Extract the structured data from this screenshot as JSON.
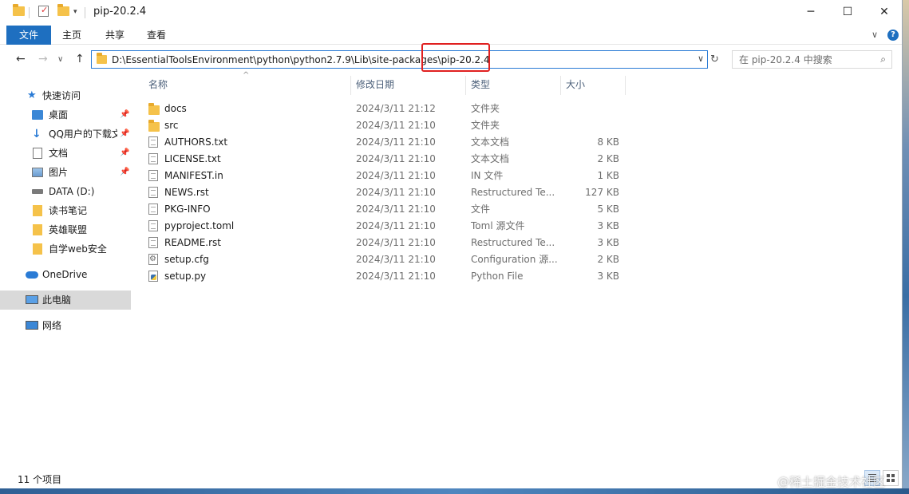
{
  "window": {
    "title": "pip-20.2.4"
  },
  "window_controls": {
    "minimize": "─",
    "maximize": "☐",
    "close": "✕"
  },
  "ribbon": {
    "tabs": [
      {
        "label": "文件"
      },
      {
        "label": "主页"
      },
      {
        "label": "共享"
      },
      {
        "label": "查看"
      }
    ],
    "expand": "∨",
    "help": "?"
  },
  "nav": {
    "back": "←",
    "forward": "→",
    "recent": "∨",
    "up": "↑",
    "address": "D:\\EssentialToolsEnvironment\\python\\python2.7.9\\Lib\\site-packages\\pip-20.2.4",
    "address_dropdown": "∨",
    "refresh": "↻",
    "search_placeholder": "在 pip-20.2.4 中搜索",
    "search_icon": "⌕"
  },
  "sidebar": {
    "items": [
      {
        "label": "快速访问",
        "icon": "star-icon",
        "pin": ""
      },
      {
        "label": "桌面",
        "icon": "desktop-icon",
        "pin": "📌"
      },
      {
        "label": "QQ用户的下载文件",
        "icon": "download-icon",
        "pin": "📌"
      },
      {
        "label": "文档",
        "icon": "documents-icon",
        "pin": "📌"
      },
      {
        "label": "图片",
        "icon": "pictures-icon",
        "pin": "📌"
      },
      {
        "label": "DATA (D:)",
        "icon": "drive-icon",
        "pin": ""
      },
      {
        "label": "读书笔记",
        "icon": "folder-icon",
        "pin": ""
      },
      {
        "label": "英雄联盟",
        "icon": "folder-icon",
        "pin": ""
      },
      {
        "label": "自学web安全",
        "icon": "folder-icon",
        "pin": ""
      },
      {
        "label": "OneDrive",
        "icon": "cloud-icon",
        "pin": ""
      },
      {
        "label": "此电脑",
        "icon": "computer-icon",
        "pin": ""
      },
      {
        "label": "网络",
        "icon": "network-icon",
        "pin": ""
      }
    ]
  },
  "list": {
    "sort_caret": "^",
    "columns": {
      "name": "名称",
      "date": "修改日期",
      "type": "类型",
      "size": "大小"
    },
    "rows": [
      {
        "name": "docs",
        "date": "2024/3/11 21:12",
        "type": "文件夹",
        "size": "",
        "icon": "folder-icon"
      },
      {
        "name": "src",
        "date": "2024/3/11 21:10",
        "type": "文件夹",
        "size": "",
        "icon": "folder-icon"
      },
      {
        "name": "AUTHORS.txt",
        "date": "2024/3/11 21:10",
        "type": "文本文档",
        "size": "8 KB",
        "icon": "text-file-icon"
      },
      {
        "name": "LICENSE.txt",
        "date": "2024/3/11 21:10",
        "type": "文本文档",
        "size": "2 KB",
        "icon": "text-file-icon"
      },
      {
        "name": "MANIFEST.in",
        "date": "2024/3/11 21:10",
        "type": "IN 文件",
        "size": "1 KB",
        "icon": "file-icon"
      },
      {
        "name": "NEWS.rst",
        "date": "2024/3/11 21:10",
        "type": "Restructured Te...",
        "size": "127 KB",
        "icon": "text-file-icon"
      },
      {
        "name": "PKG-INFO",
        "date": "2024/3/11 21:10",
        "type": "文件",
        "size": "5 KB",
        "icon": "file-icon"
      },
      {
        "name": "pyproject.toml",
        "date": "2024/3/11 21:10",
        "type": "Toml 源文件",
        "size": "3 KB",
        "icon": "text-file-icon"
      },
      {
        "name": "README.rst",
        "date": "2024/3/11 21:10",
        "type": "Restructured Te...",
        "size": "3 KB",
        "icon": "text-file-icon"
      },
      {
        "name": "setup.cfg",
        "date": "2024/3/11 21:10",
        "type": "Configuration 源...",
        "size": "2 KB",
        "icon": "config-file-icon"
      },
      {
        "name": "setup.py",
        "date": "2024/3/11 21:10",
        "type": "Python File",
        "size": "3 KB",
        "icon": "python-file-icon"
      }
    ]
  },
  "status": {
    "count": "11 个项目"
  },
  "watermark": "@稀土掘金技术社区",
  "colors": {
    "accent": "#1e6fc0",
    "highlight": "#e02020",
    "selected": "#d9d9d9"
  }
}
